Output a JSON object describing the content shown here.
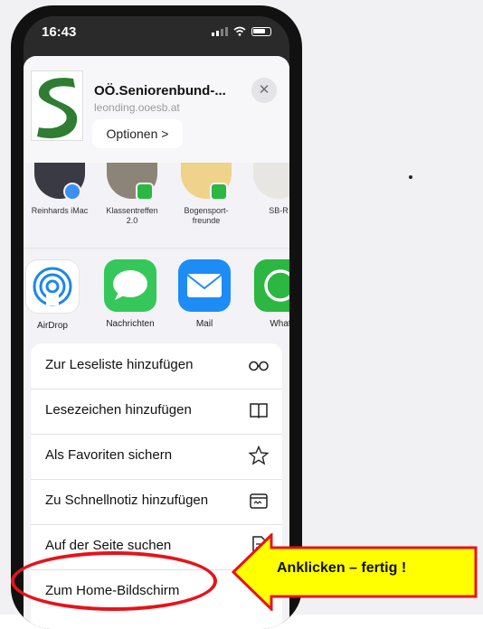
{
  "status": {
    "time": "16:43"
  },
  "header": {
    "title": "OÖ.Seniorenbund-...",
    "url": "leonding.ooesb.at",
    "options_label": "Optionen >",
    "close_symbol": "✕"
  },
  "people": [
    {
      "label": "Reinhards iMac"
    },
    {
      "label": "Klassentreffen 2.0"
    },
    {
      "label": "Bogensport- freunde"
    },
    {
      "label": "SB-R"
    }
  ],
  "apps": [
    {
      "label": "AirDrop"
    },
    {
      "label": "Nachrichten"
    },
    {
      "label": "Mail"
    },
    {
      "label": "What"
    }
  ],
  "actions": [
    {
      "label": "Zur Leseliste hinzufügen",
      "icon": "glasses-icon"
    },
    {
      "label": "Lesezeichen hinzufügen",
      "icon": "book-icon"
    },
    {
      "label": "Als Favoriten sichern",
      "icon": "star-icon"
    },
    {
      "label": "Zu Schnellnotiz hinzufügen",
      "icon": "quick-note-icon"
    },
    {
      "label": "Auf der Seite suchen",
      "icon": "find-on-page-icon"
    },
    {
      "label": "Zum Home-Bildschirm",
      "icon": "add-to-home-icon"
    }
  ],
  "annotation": {
    "callout_text": "Anklicken – fertig !",
    "highlight_color": "#e5141b",
    "callout_fill": "#ffff00"
  }
}
